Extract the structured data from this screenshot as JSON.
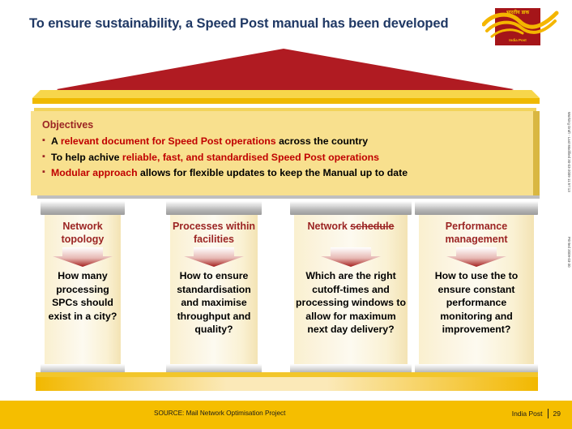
{
  "slide": {
    "title": "To ensure sustainability,  a Speed Post manual has been developed",
    "accent_red": "#C00000",
    "dark_red": "#9B2423",
    "title_color": "#1F3864",
    "yellow": "#F5BE00",
    "box_yellow": "#F8E08E"
  },
  "logo": {
    "name": "india-post-logo",
    "hindi_text": "भारतीय डाक",
    "english_text": "India Post"
  },
  "objectives": {
    "heading": "Objectives",
    "bullet_glyph": "▪",
    "items": [
      {
        "pre": "A ",
        "highlight": "relevant document for Speed Post operations",
        "post": " across the country"
      },
      {
        "pre": "To help  achive ",
        "highlight": "reliable, fast, and standardised Speed Post operations",
        "post": ""
      },
      {
        "pre": "",
        "highlight": "Modular approach",
        "post": " allows for flexible updates to keep the Manual up to date"
      }
    ]
  },
  "columns": [
    {
      "header": "Network topology",
      "header_strike": "",
      "question": "How many processing SPCs should exist in a city?"
    },
    {
      "header": "Processes within facilities",
      "header_strike": "",
      "question": "How to ensure standardisation and maximise throughput and quality?"
    },
    {
      "header": "Network ",
      "header_strike": "schedule",
      "question": "Which are the right cutoff-times and processing windows to allow for maximum next day delivery?"
    },
    {
      "header": "Performance management",
      "header_strike": "",
      "question": "How to use the to ensure constant performance monitoring and improvement?"
    }
  ],
  "footer": {
    "source": "SOURCE: Mail Network Optimisation Project",
    "brand": "India Post",
    "page_number": "29"
  },
  "sidenotes": {
    "line1": "Working Draft - Last Modified 30-03-2009 11:57:13",
    "line2": "Printed 2009-03-30"
  }
}
